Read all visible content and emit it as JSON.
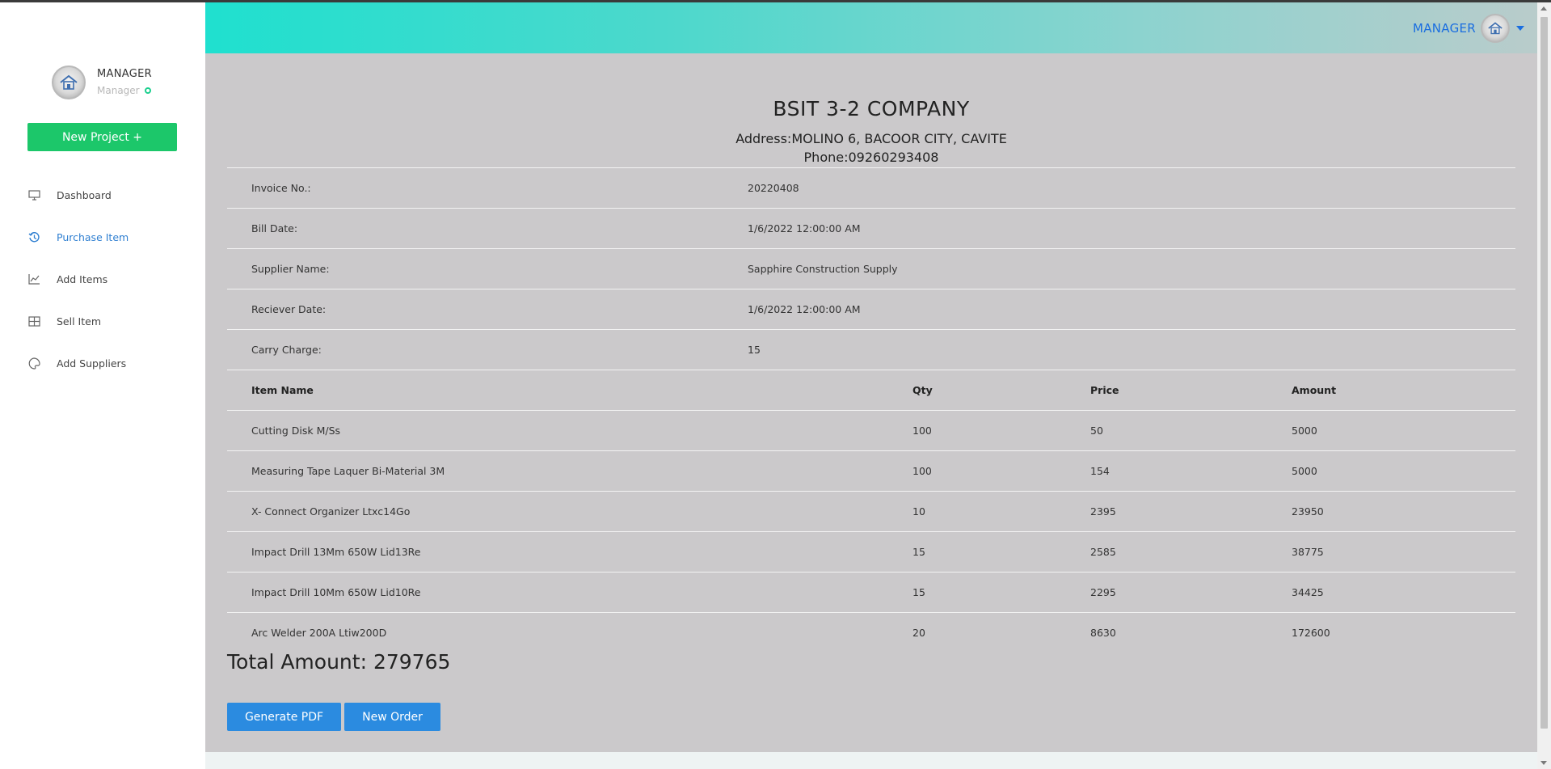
{
  "sidebar": {
    "profile": {
      "name": "MANAGER",
      "role": "Manager"
    },
    "new_project_label": "New Project +",
    "items": [
      {
        "label": "Dashboard",
        "icon": "monitor-icon"
      },
      {
        "label": "Purchase Item",
        "icon": "history-icon",
        "active": true
      },
      {
        "label": "Add Items",
        "icon": "line-chart-icon"
      },
      {
        "label": "Sell Item",
        "icon": "table-grid-icon"
      },
      {
        "label": "Add Suppliers",
        "icon": "palette-icon"
      }
    ]
  },
  "header": {
    "user_label": "MANAGER"
  },
  "invoice": {
    "company_name": "BSIT 3-2 COMPANY",
    "address": "Address:MOLINO 6, BACOOR CITY, CAVITE",
    "phone": "Phone:09260293408",
    "fields": [
      {
        "label": "Invoice No.:",
        "value": "20220408"
      },
      {
        "label": "Bill Date:",
        "value": "1/6/2022 12:00:00 AM"
      },
      {
        "label": "Supplier Name:",
        "value": "Sapphire Construction Supply"
      },
      {
        "label": "Reciever Date:",
        "value": "1/6/2022 12:00:00 AM"
      },
      {
        "label": "Carry Charge:",
        "value": "15"
      }
    ],
    "columns": [
      "Item Name",
      "Qty",
      "Price",
      "Amount"
    ],
    "items": [
      {
        "name": "Cutting Disk M/Ss",
        "qty": "100",
        "price": "50",
        "amount": "5000"
      },
      {
        "name": "Measuring Tape Laquer Bi-Material 3M",
        "qty": "100",
        "price": "154",
        "amount": "5000"
      },
      {
        "name": "X- Connect Organizer Ltxc14Go",
        "qty": "10",
        "price": "2395",
        "amount": "23950"
      },
      {
        "name": "Impact Drill 13Mm 650W Lid13Re",
        "qty": "15",
        "price": "2585",
        "amount": "38775"
      },
      {
        "name": "Impact Drill 10Mm 650W Lid10Re",
        "qty": "15",
        "price": "2295",
        "amount": "34425"
      },
      {
        "name": "Arc Welder 200A Ltiw200D",
        "qty": "20",
        "price": "8630",
        "amount": "172600"
      }
    ],
    "total": "Total Amount: 279765"
  },
  "actions": {
    "generate_pdf": "Generate PDF",
    "new_order": "New Order"
  },
  "colors": {
    "accent": "#2b8be0",
    "new_project": "#1cc76a",
    "active_nav": "#2f7fd1",
    "panel": "#cbc9cb"
  }
}
